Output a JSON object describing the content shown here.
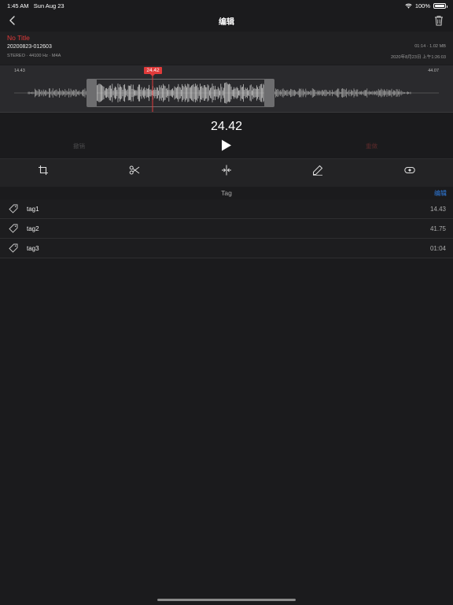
{
  "status_bar": {
    "time": "1:45 AM",
    "date": "Sun Aug 23",
    "battery": "100%"
  },
  "nav": {
    "title": "编辑"
  },
  "recording": {
    "title": "No Title",
    "filename": "20200823-012603",
    "meta": "STEREO · 44100 Hz · M4A",
    "duration_size": "01:14 · 1.02 MB",
    "date": "2020年8月23日 上午1:26:03"
  },
  "waveform": {
    "start_time": "14.43",
    "end_time": "44.07",
    "playhead_label": "24.42",
    "playhead_color": "#e03a3a"
  },
  "controls": {
    "current_time": "24.42",
    "undo_label": "撤销",
    "redo_label": "重做"
  },
  "toolbar": {
    "tools": [
      "crop-icon",
      "scissors-icon",
      "split-icon",
      "pencil-icon",
      "tag-add-icon"
    ]
  },
  "tags": {
    "header": "Tag",
    "edit_label": "编辑",
    "items": [
      {
        "name": "tag1",
        "time": "14.43"
      },
      {
        "name": "tag2",
        "time": "41.75"
      },
      {
        "name": "tag3",
        "time": "01:04"
      }
    ]
  },
  "colors": {
    "accent_red": "#e03a3a",
    "accent_blue": "#2f7de1",
    "background": "#1b1b1d"
  }
}
